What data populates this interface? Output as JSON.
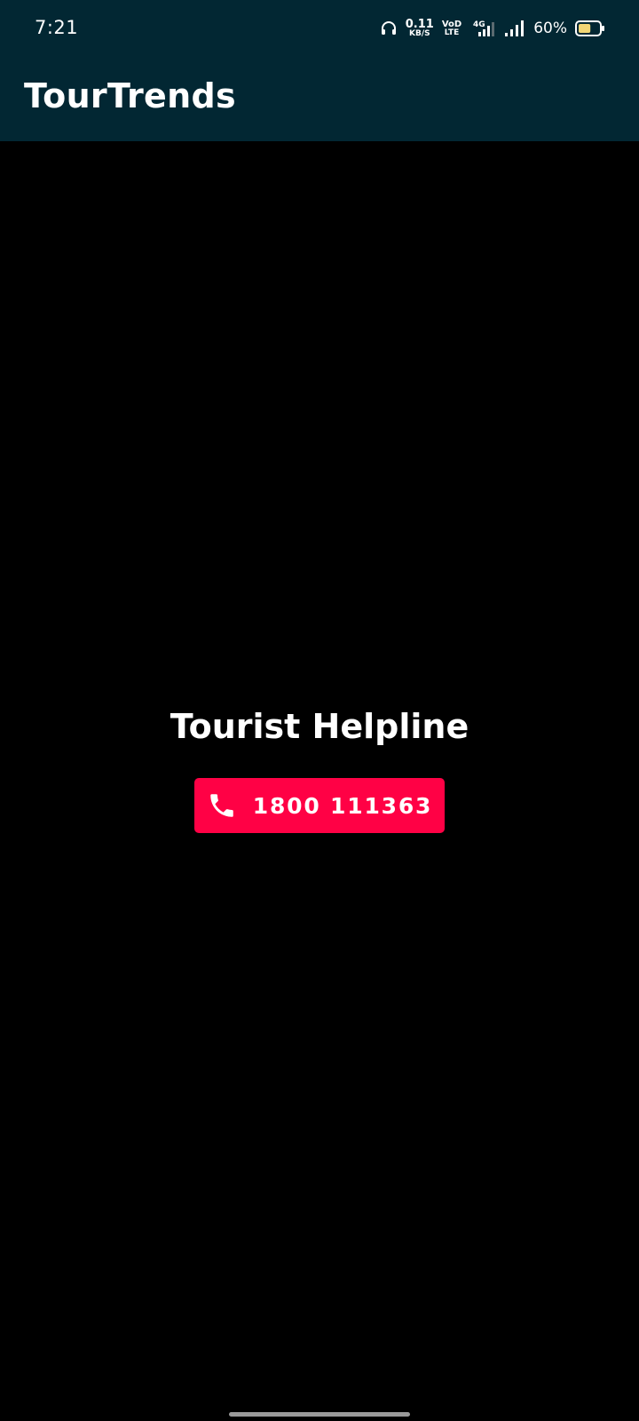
{
  "status_bar": {
    "time": "7:21",
    "network_speed_value": "0.11",
    "network_speed_unit": "KB/S",
    "volte_line1": "VoD",
    "volte_line2": "LTE",
    "network_type": "4G",
    "battery_percent": "60%",
    "battery_level": 0.6,
    "battery_color": "#f2d675",
    "icons": [
      "headphones-icon",
      "network-speed-icon",
      "volte-icon",
      "signal-4g-icon",
      "signal-icon",
      "battery-icon"
    ]
  },
  "app_bar": {
    "title": "TourTrends",
    "background": "#022733"
  },
  "main": {
    "heading": "Tourist Helpline",
    "call_button": {
      "icon": "phone-icon",
      "label": "1800 111363",
      "color": "#ff0145"
    }
  }
}
